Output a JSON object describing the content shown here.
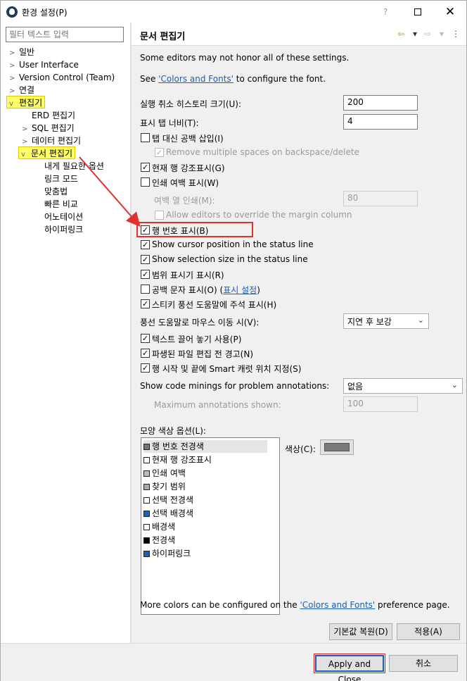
{
  "window": {
    "title": "환경 설정(P)",
    "help_glyph": "?",
    "close_glyph": "✕"
  },
  "tree": {
    "filter_placeholder": "필터 텍스트 입력",
    "items": [
      {
        "label": "일반",
        "arrow": ">"
      },
      {
        "label": "User Interface",
        "arrow": ">"
      },
      {
        "label": "Version Control (Team)",
        "arrow": ">"
      },
      {
        "label": "연결",
        "arrow": ">"
      },
      {
        "label": "편집기",
        "arrow": "v"
      },
      {
        "label": "ERD 편집기",
        "arrow": ""
      },
      {
        "label": "SQL 편집기",
        "arrow": ">"
      },
      {
        "label": "데이터 편집기",
        "arrow": ">"
      },
      {
        "label": "문서 편집기",
        "arrow": "v"
      },
      {
        "label": "내게 필요한 옵션",
        "arrow": ""
      },
      {
        "label": "링크 모드",
        "arrow": ""
      },
      {
        "label": "맞춤법",
        "arrow": ""
      },
      {
        "label": "빠른 비교",
        "arrow": ""
      },
      {
        "label": "어노테이션",
        "arrow": ""
      },
      {
        "label": "하이퍼링크",
        "arrow": ""
      }
    ]
  },
  "page": {
    "title": "문서 편집기",
    "nav": {
      "back": "⇦",
      "dropdown": "▾",
      "forward": "⇨"
    },
    "note": "Some editors may not honor all of these settings.",
    "see_prefix": "See ",
    "see_link": "'Colors and Fonts'",
    "see_suffix": " to configure the font.",
    "undo_history_label": "실행 취소 히스토리 크기(U):",
    "undo_history_value": "200",
    "tab_width_label": "표시 탭 너비(T):",
    "tab_width_value": "4",
    "options": [
      {
        "label": "탭 대신 공백 삽입(I)",
        "checked": false
      },
      {
        "label": "Remove multiple spaces on backspace/delete",
        "checked": true,
        "disabled": true
      },
      {
        "label": "현재 행 강조표시(G)",
        "checked": true
      },
      {
        "label": "인쇄 여백 표시(W)",
        "checked": false
      }
    ],
    "print_margin_label": "여백 열 인쇄(M):",
    "print_margin_value": "80",
    "allow_override_label": "Allow editors to override the margin column",
    "options2": [
      {
        "label": "행 번호 표시(B)",
        "checked": true
      },
      {
        "label": "Show cursor position in the status line",
        "checked": true
      },
      {
        "label": "Show selection size in the status line",
        "checked": true
      },
      {
        "label": "범위 표시기 표시(R)",
        "checked": true
      },
      {
        "label": "공백 문자 표시(O)",
        "checked": false
      },
      {
        "label": "스티키 풍선 도움말에 주석 표시(H)",
        "checked": true
      }
    ],
    "whitespace_link_prefix": "(",
    "whitespace_link": "표시 설정",
    "whitespace_link_suffix": ")",
    "hover_label": "풍선 도움말로 마우스 이동 시(V):",
    "hover_value": "지연 후 보강",
    "options3": [
      {
        "label": "텍스트 끌어 놓기 사용(P)",
        "checked": true
      },
      {
        "label": "파생된 파일 편집 전 경고(N)",
        "checked": true
      },
      {
        "label": "행 시작 및 끝에 Smart 캐럿 위치 지정(S)",
        "checked": true
      }
    ],
    "code_minings_label": "Show code minings for problem annotations:",
    "code_minings_value": "없음",
    "max_annotations_label": "Maximum annotations shown:",
    "max_annotations_value": "100",
    "appearance_label": "모양 색상 옵션(L):",
    "colors": [
      {
        "label": "행 번호 전경색",
        "swatch": "#777777"
      },
      {
        "label": "현재 행 강조표시",
        "swatch": "#ffffff"
      },
      {
        "label": "인쇄 여백",
        "swatch": "#bbbbbb"
      },
      {
        "label": "찾기 범위",
        "swatch": "#aaaaaa"
      },
      {
        "label": "선택 전경색",
        "swatch": "#ffffff"
      },
      {
        "label": "선택 배경색",
        "swatch": "#1565c0"
      },
      {
        "label": "배경색",
        "swatch": "#ffffff"
      },
      {
        "label": "전경색",
        "swatch": "#000000"
      },
      {
        "label": "하이퍼링크",
        "swatch": "#1565c0"
      }
    ],
    "color_label": "색상(C):",
    "more_colors_prefix": "More colors can be configured on the ",
    "more_colors_link": "'Colors and Fonts'",
    "more_colors_suffix": " preference page.",
    "restore_defaults": "기본값 복원(D)",
    "apply": "적용(A)"
  },
  "footer": {
    "apply_close": "Apply and Close",
    "cancel": "취소"
  }
}
